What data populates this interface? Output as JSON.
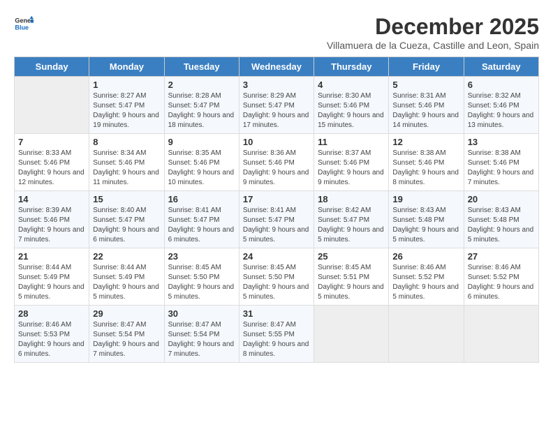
{
  "header": {
    "logo_line1": "General",
    "logo_line2": "Blue",
    "month": "December 2025",
    "location": "Villamuera de la Cueza, Castille and Leon, Spain"
  },
  "weekdays": [
    "Sunday",
    "Monday",
    "Tuesday",
    "Wednesday",
    "Thursday",
    "Friday",
    "Saturday"
  ],
  "weeks": [
    [
      {
        "day": null
      },
      {
        "day": "1",
        "sunrise": "8:27 AM",
        "sunset": "5:47 PM",
        "daylight": "9 hours and 19 minutes."
      },
      {
        "day": "2",
        "sunrise": "8:28 AM",
        "sunset": "5:47 PM",
        "daylight": "9 hours and 18 minutes."
      },
      {
        "day": "3",
        "sunrise": "8:29 AM",
        "sunset": "5:47 PM",
        "daylight": "9 hours and 17 minutes."
      },
      {
        "day": "4",
        "sunrise": "8:30 AM",
        "sunset": "5:46 PM",
        "daylight": "9 hours and 15 minutes."
      },
      {
        "day": "5",
        "sunrise": "8:31 AM",
        "sunset": "5:46 PM",
        "daylight": "9 hours and 14 minutes."
      },
      {
        "day": "6",
        "sunrise": "8:32 AM",
        "sunset": "5:46 PM",
        "daylight": "9 hours and 13 minutes."
      }
    ],
    [
      {
        "day": "7",
        "sunrise": "8:33 AM",
        "sunset": "5:46 PM",
        "daylight": "9 hours and 12 minutes."
      },
      {
        "day": "8",
        "sunrise": "8:34 AM",
        "sunset": "5:46 PM",
        "daylight": "9 hours and 11 minutes."
      },
      {
        "day": "9",
        "sunrise": "8:35 AM",
        "sunset": "5:46 PM",
        "daylight": "9 hours and 10 minutes."
      },
      {
        "day": "10",
        "sunrise": "8:36 AM",
        "sunset": "5:46 PM",
        "daylight": "9 hours and 9 minutes."
      },
      {
        "day": "11",
        "sunrise": "8:37 AM",
        "sunset": "5:46 PM",
        "daylight": "9 hours and 9 minutes."
      },
      {
        "day": "12",
        "sunrise": "8:38 AM",
        "sunset": "5:46 PM",
        "daylight": "9 hours and 8 minutes."
      },
      {
        "day": "13",
        "sunrise": "8:38 AM",
        "sunset": "5:46 PM",
        "daylight": "9 hours and 7 minutes."
      }
    ],
    [
      {
        "day": "14",
        "sunrise": "8:39 AM",
        "sunset": "5:46 PM",
        "daylight": "9 hours and 7 minutes."
      },
      {
        "day": "15",
        "sunrise": "8:40 AM",
        "sunset": "5:47 PM",
        "daylight": "9 hours and 6 minutes."
      },
      {
        "day": "16",
        "sunrise": "8:41 AM",
        "sunset": "5:47 PM",
        "daylight": "9 hours and 6 minutes."
      },
      {
        "day": "17",
        "sunrise": "8:41 AM",
        "sunset": "5:47 PM",
        "daylight": "9 hours and 5 minutes."
      },
      {
        "day": "18",
        "sunrise": "8:42 AM",
        "sunset": "5:47 PM",
        "daylight": "9 hours and 5 minutes."
      },
      {
        "day": "19",
        "sunrise": "8:43 AM",
        "sunset": "5:48 PM",
        "daylight": "9 hours and 5 minutes."
      },
      {
        "day": "20",
        "sunrise": "8:43 AM",
        "sunset": "5:48 PM",
        "daylight": "9 hours and 5 minutes."
      }
    ],
    [
      {
        "day": "21",
        "sunrise": "8:44 AM",
        "sunset": "5:49 PM",
        "daylight": "9 hours and 5 minutes."
      },
      {
        "day": "22",
        "sunrise": "8:44 AM",
        "sunset": "5:49 PM",
        "daylight": "9 hours and 5 minutes."
      },
      {
        "day": "23",
        "sunrise": "8:45 AM",
        "sunset": "5:50 PM",
        "daylight": "9 hours and 5 minutes."
      },
      {
        "day": "24",
        "sunrise": "8:45 AM",
        "sunset": "5:50 PM",
        "daylight": "9 hours and 5 minutes."
      },
      {
        "day": "25",
        "sunrise": "8:45 AM",
        "sunset": "5:51 PM",
        "daylight": "9 hours and 5 minutes."
      },
      {
        "day": "26",
        "sunrise": "8:46 AM",
        "sunset": "5:52 PM",
        "daylight": "9 hours and 5 minutes."
      },
      {
        "day": "27",
        "sunrise": "8:46 AM",
        "sunset": "5:52 PM",
        "daylight": "9 hours and 6 minutes."
      }
    ],
    [
      {
        "day": "28",
        "sunrise": "8:46 AM",
        "sunset": "5:53 PM",
        "daylight": "9 hours and 6 minutes."
      },
      {
        "day": "29",
        "sunrise": "8:47 AM",
        "sunset": "5:54 PM",
        "daylight": "9 hours and 7 minutes."
      },
      {
        "day": "30",
        "sunrise": "8:47 AM",
        "sunset": "5:54 PM",
        "daylight": "9 hours and 7 minutes."
      },
      {
        "day": "31",
        "sunrise": "8:47 AM",
        "sunset": "5:55 PM",
        "daylight": "9 hours and 8 minutes."
      },
      {
        "day": null
      },
      {
        "day": null
      },
      {
        "day": null
      }
    ]
  ],
  "labels": {
    "sunrise": "Sunrise:",
    "sunset": "Sunset:",
    "daylight": "Daylight:"
  }
}
